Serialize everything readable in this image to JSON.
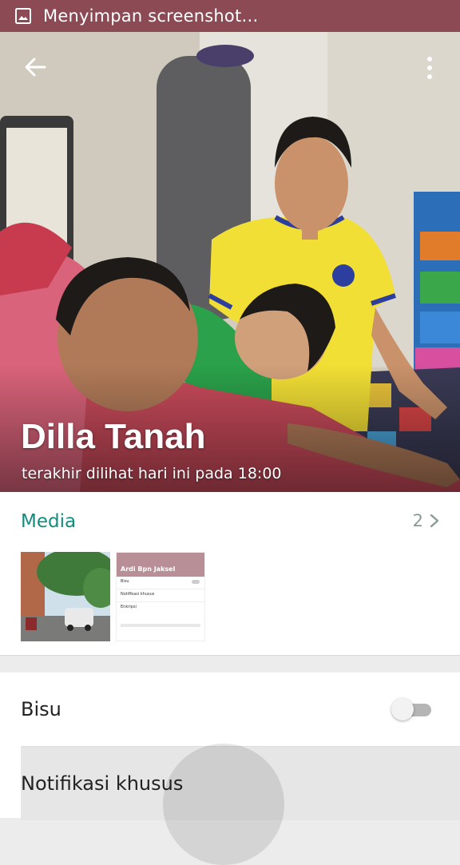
{
  "status_bar": {
    "text": "Menyimpan screenshot…",
    "icon": "image-icon"
  },
  "contact": {
    "name": "Dilla Tanah",
    "last_seen": "terakhir dilihat hari ini pada 18:00"
  },
  "toolbar": {
    "back_icon": "arrow-back-icon",
    "menu_icon": "more-vert-icon"
  },
  "media": {
    "title": "Media",
    "count": "2",
    "thumbnails": [
      {
        "type": "photo"
      },
      {
        "type": "screenshot",
        "header": "Ardi Bpn Jaksel",
        "rows": [
          "Bisu",
          "Notifikasi khusus",
          "Enkripsi"
        ]
      }
    ]
  },
  "settings": {
    "mute_label": "Bisu",
    "mute_on": false,
    "custom_notifications_label": "Notifikasi khusus"
  },
  "colors": {
    "accent": "#128c7e",
    "status_bar": "#8c4a55"
  }
}
